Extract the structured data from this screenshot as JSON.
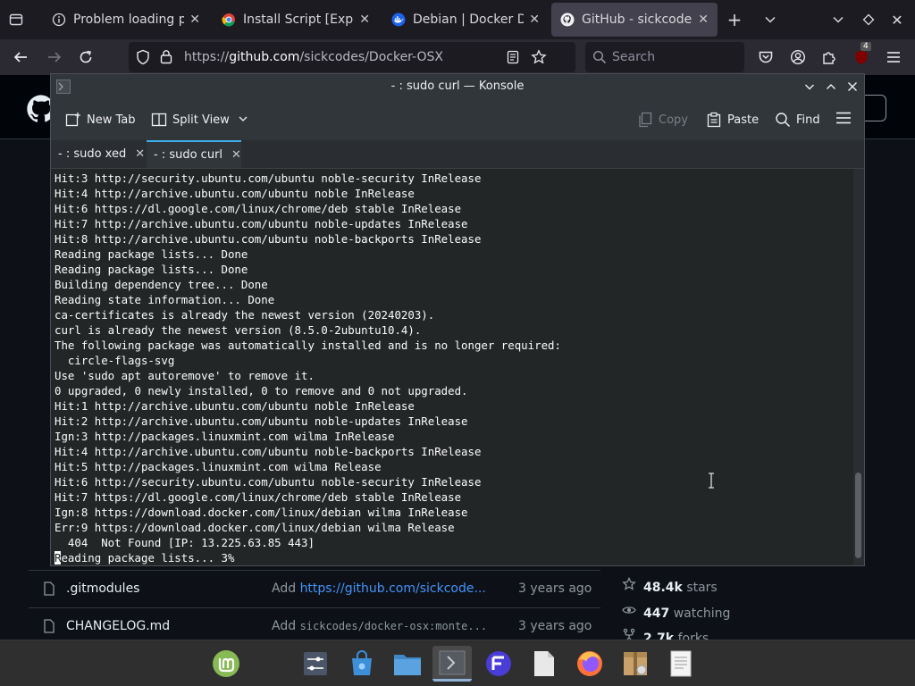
{
  "firefox": {
    "tabs": [
      {
        "title": "Problem loading page",
        "icon": "info-icon"
      },
      {
        "title": "Install Script [Experimental]",
        "icon": "chrome-favicon"
      },
      {
        "title": "Debian | Docker Docs",
        "icon": "docker-favicon"
      },
      {
        "title": "GitHub - sickcodes/Docker-OSX",
        "icon": "github-favicon",
        "active": true
      }
    ],
    "url_prefix": "https://",
    "url_host": "github.com",
    "url_path": "/sickcodes/Docker-OSX",
    "search_placeholder": "Search",
    "ublock_count": "4"
  },
  "github": {
    "files": [
      {
        "name": ".gitmodules",
        "commit_prefix": "Add ",
        "commit_link": "https://github.com/sickcode...",
        "commit_rest": "",
        "age": "3 years ago"
      },
      {
        "name": "CHANGELOG.md",
        "commit_prefix": "Add ",
        "commit_link": "",
        "commit_rest": "sickcodes/docker-osx:monte...",
        "age": "3 years ago"
      }
    ],
    "stats": [
      {
        "value": "48.4k",
        "label": "stars",
        "icon": "star-icon"
      },
      {
        "value": "447",
        "label": "watching",
        "icon": "eye-icon"
      },
      {
        "value": "2.7k",
        "label": "forks",
        "icon": "fork-icon"
      }
    ]
  },
  "konsole": {
    "title": "- : sudo curl — Konsole",
    "toolbar": {
      "new_tab": "New Tab",
      "split_view": "Split View",
      "copy": "Copy",
      "paste": "Paste",
      "find": "Find"
    },
    "tabs": [
      {
        "label": "- : sudo xed"
      },
      {
        "label": "- : sudo curl",
        "active": true
      }
    ],
    "terminal_lines": [
      "Hit:3 http://security.ubuntu.com/ubuntu noble-security InRelease",
      "Hit:4 http://archive.ubuntu.com/ubuntu noble InRelease",
      "Hit:6 https://dl.google.com/linux/chrome/deb stable InRelease",
      "Hit:7 http://archive.ubuntu.com/ubuntu noble-updates InRelease",
      "Hit:8 http://archive.ubuntu.com/ubuntu noble-backports InRelease",
      "Reading package lists... Done",
      "Reading package lists... Done",
      "Building dependency tree... Done",
      "Reading state information... Done",
      "ca-certificates is already the newest version (20240203).",
      "curl is already the newest version (8.5.0-2ubuntu10.4).",
      "The following package was automatically installed and is no longer required:",
      "  circle-flags-svg",
      "Use 'sudo apt autoremove' to remove it.",
      "0 upgraded, 0 newly installed, 0 to remove and 0 not upgraded.",
      "Hit:1 http://archive.ubuntu.com/ubuntu noble InRelease",
      "Hit:2 http://archive.ubuntu.com/ubuntu noble-updates InRelease",
      "Ign:3 http://packages.linuxmint.com wilma InRelease",
      "Hit:4 http://archive.ubuntu.com/ubuntu noble-backports InRelease",
      "Hit:5 http://packages.linuxmint.com wilma Release",
      "Hit:6 http://security.ubuntu.com/ubuntu noble-security InRelease",
      "Hit:7 https://dl.google.com/linux/chrome/deb stable InRelease",
      "Ign:8 https://download.docker.com/linux/debian wilma InRelease",
      "Err:9 https://download.docker.com/linux/debian wilma Release",
      "  404  Not Found [IP: 13.225.63.85 443]"
    ],
    "prompt_cursor_char": "R",
    "prompt_rest": "eading package lists... 3%"
  },
  "taskbar": {
    "apps": [
      "mint-menu-icon",
      "settings-icon",
      "software-manager-icon",
      "files-icon",
      "terminal-icon",
      "fontforge-icon",
      "text-editor-icon",
      "firefox-icon",
      "archive-icon",
      "document-icon"
    ]
  }
}
